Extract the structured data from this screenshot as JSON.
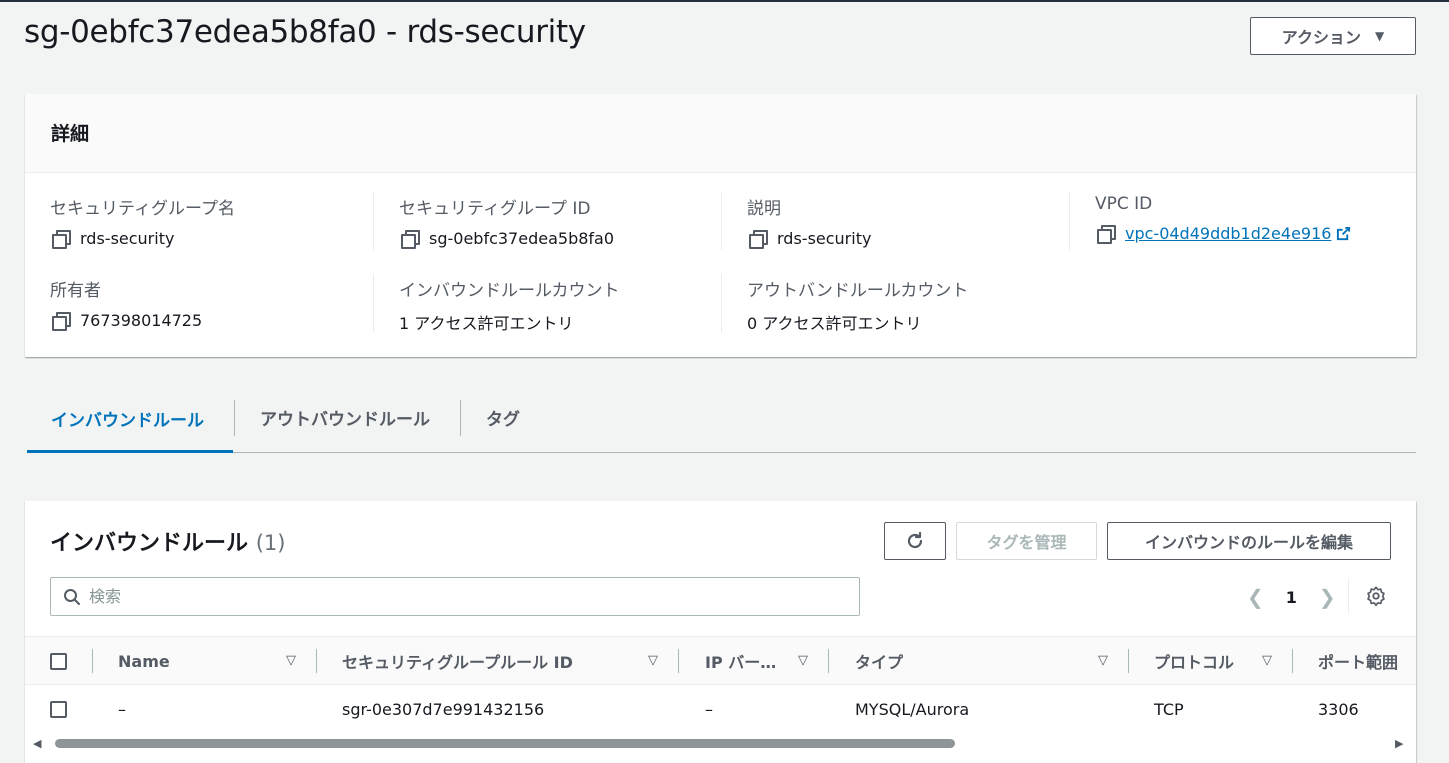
{
  "header": {
    "title": "sg-0ebfc37edea5b8fa0 - rds-security",
    "actions_label": "アクション"
  },
  "details": {
    "heading": "詳細",
    "fields": {
      "sg_name": {
        "label": "セキュリティグループ名",
        "value": "rds-security"
      },
      "sg_id": {
        "label": "セキュリティグループ ID",
        "value": "sg-0ebfc37edea5b8fa0"
      },
      "description": {
        "label": "説明",
        "value": "rds-security"
      },
      "vpc_id": {
        "label": "VPC ID",
        "value": "vpc-04d49ddb1d2e4e916"
      },
      "owner": {
        "label": "所有者",
        "value": "767398014725"
      },
      "inbound_count": {
        "label": "インバウンドルールカウント",
        "value": "1 アクセス許可エントリ"
      },
      "outbound_count": {
        "label": "アウトバンドルールカウント",
        "value": "0 アクセス許可エントリ"
      }
    }
  },
  "tabs": [
    {
      "label": "インバウンドルール",
      "active": true
    },
    {
      "label": "アウトバウンドルール",
      "active": false
    },
    {
      "label": "タグ",
      "active": false
    }
  ],
  "rules": {
    "title": "インバウンドルール",
    "count": "(1)",
    "manage_tags_label": "タグを管理",
    "edit_label": "インバウンドのルールを編集",
    "search_placeholder": "検索",
    "page": "1",
    "columns": [
      "Name",
      "セキュリティグループルール ID",
      "IP バー…",
      "タイプ",
      "プロトコル",
      "ポート範囲"
    ],
    "rows": [
      {
        "name": "–",
        "rule_id": "sgr-0e307d7e991432156",
        "ip_version": "–",
        "type": "MYSQL/Aurora",
        "protocol": "TCP",
        "port_range": "3306"
      }
    ]
  },
  "colors": {
    "accent": "#0073bb",
    "background": "#f2f3f3",
    "text": "#16191f",
    "muted": "#545b64"
  }
}
